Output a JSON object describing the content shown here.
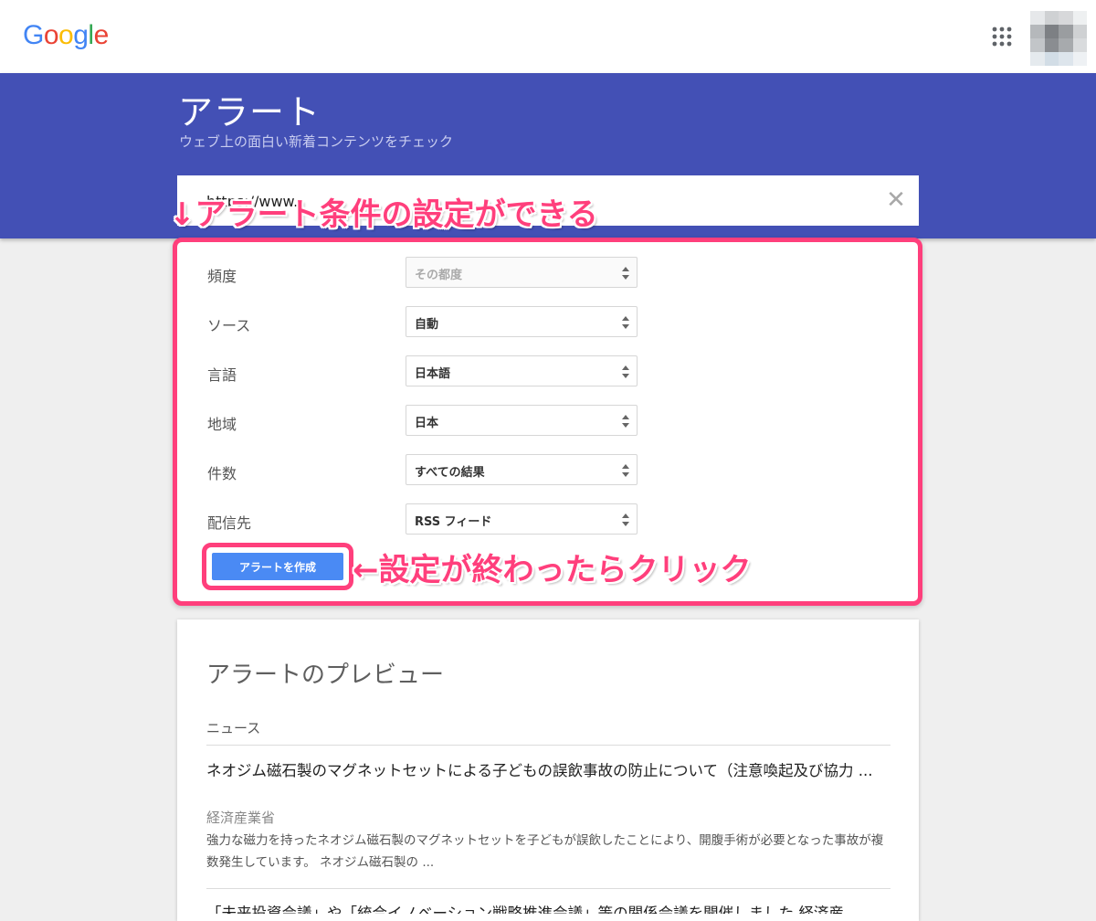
{
  "header": {
    "logo_letters": [
      "G",
      "o",
      "o",
      "g",
      "l",
      "e"
    ],
    "logo_colors": [
      "#4285F4",
      "#EA4335",
      "#FBBC05",
      "#4285F4",
      "#34A853",
      "#EA4335"
    ]
  },
  "hero": {
    "title": "アラート",
    "subtitle": "ウェブ上の面白い新着コンテンツをチェック",
    "query_value": "https://www.",
    "background": "#4350b5"
  },
  "annotations": {
    "top": "↓アラート条件の設定ができる",
    "button_hint": "←設定が終わったらクリック",
    "color": "#ff3f7c"
  },
  "options": {
    "rows": [
      {
        "label": "頻度",
        "value": "その都度",
        "disabled": true
      },
      {
        "label": "ソース",
        "value": "自動",
        "disabled": false
      },
      {
        "label": "言語",
        "value": "日本語",
        "disabled": false
      },
      {
        "label": "地域",
        "value": "日本",
        "disabled": false
      },
      {
        "label": "件数",
        "value": "すべての結果",
        "disabled": false
      },
      {
        "label": "配信先",
        "value": "RSS フィード",
        "disabled": false
      }
    ],
    "create_button": "アラートを作成"
  },
  "preview": {
    "title": "アラートのプレビュー",
    "section": "ニュース",
    "article": {
      "title": "ネオジム磁石製のマグネットセットによる子どもの誤飲事故の防止について（注意喚起及び協力 ...",
      "source": "経済産業省",
      "snippet": "強力な磁力を持ったネオジム磁石製のマグネットセットを子どもが誤飲したことにより、開腹手術が必要となった事故が複数発生しています。 ネオジム磁石製の ..."
    },
    "article2": {
      "title": "「未来投資会議」や「統合イノベーション戦略推進会議」等の関係会議を開催しました 経済産"
    }
  }
}
